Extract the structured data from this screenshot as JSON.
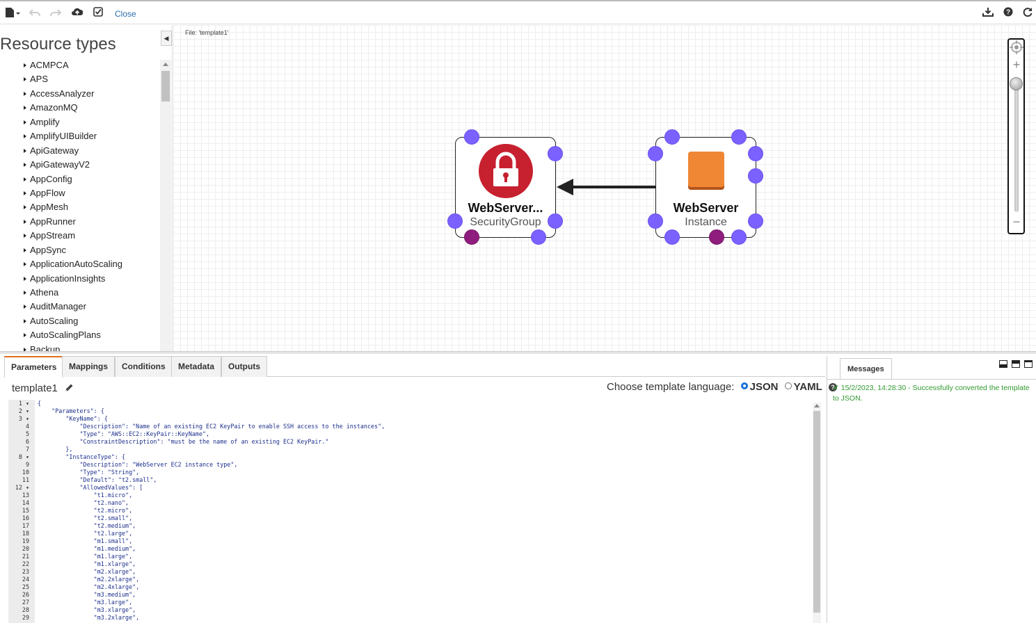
{
  "toolbar": {
    "close_label": "Close",
    "icons": [
      "file-menu-icon",
      "undo-icon",
      "redo-icon",
      "cloud-upload-icon",
      "validate-icon",
      "download-icon",
      "help-icon",
      "refresh-icon"
    ]
  },
  "sidebar": {
    "title": "Resource types",
    "items": [
      "ACMPCA",
      "APS",
      "AccessAnalyzer",
      "AmazonMQ",
      "Amplify",
      "AmplifyUIBuilder",
      "ApiGateway",
      "ApiGatewayV2",
      "AppConfig",
      "AppFlow",
      "AppMesh",
      "AppRunner",
      "AppStream",
      "AppSync",
      "ApplicationAutoScaling",
      "ApplicationInsights",
      "Athena",
      "AuditManager",
      "AutoScaling",
      "AutoScalingPlans",
      "Backup"
    ]
  },
  "canvas": {
    "file_label": "File: 'template1'",
    "nodes": [
      {
        "name": "WebServer...",
        "type": "SecurityGroup",
        "icon": "lock-icon"
      },
      {
        "name": "WebServer",
        "type": "Instance",
        "icon": "instance-icon"
      }
    ]
  },
  "tabs": [
    "Parameters",
    "Mappings",
    "Conditions",
    "Metadata",
    "Outputs"
  ],
  "active_tab": "Parameters",
  "template_name": "template1",
  "language": {
    "prompt": "Choose template language:",
    "json_label": "JSON",
    "yaml_label": "YAML",
    "selected": "JSON"
  },
  "editor": {
    "lines": [
      "{",
      "    \"Parameters\": {",
      "        \"KeyName\": {",
      "            \"Description\": \"Name of an existing EC2 KeyPair to enable SSH access to the instances\",",
      "            \"Type\": \"AWS::EC2::KeyPair::KeyName\",",
      "            \"ConstraintDescription\": \"must be the name of an existing EC2 KeyPair.\"",
      "        },",
      "        \"InstanceType\": {",
      "            \"Description\": \"WebServer EC2 instance type\",",
      "            \"Type\": \"String\",",
      "            \"Default\": \"t2.small\",",
      "            \"AllowedValues\": [",
      "                \"t1.micro\",",
      "                \"t2.nano\",",
      "                \"t2.micro\",",
      "                \"t2.small\",",
      "                \"t2.medium\",",
      "                \"t2.large\",",
      "                \"m1.small\",",
      "                \"m1.medium\",",
      "                \"m1.large\",",
      "                \"m1.xlarge\",",
      "                \"m2.xlarge\",",
      "                \"m2.2xlarge\",",
      "                \"m2.4xlarge\",",
      "                \"m3.medium\",",
      "                \"m3.large\",",
      "                \"m3.xlarge\",",
      "                \"m3.2xlarge\","
    ],
    "fold_lines": [
      1,
      2,
      3,
      8,
      12
    ]
  },
  "messages": {
    "tab_label": "Messages",
    "items": [
      "15/2/2023, 14:28:30 - Successfully converted the template to JSON."
    ]
  },
  "colors": {
    "port": "#7b61ff",
    "port_alt": "#8e1d7e",
    "security_group": "#c7202f",
    "instance": "#f08734",
    "success": "#2f9a2f",
    "active_tab_accent": "#e07020"
  }
}
